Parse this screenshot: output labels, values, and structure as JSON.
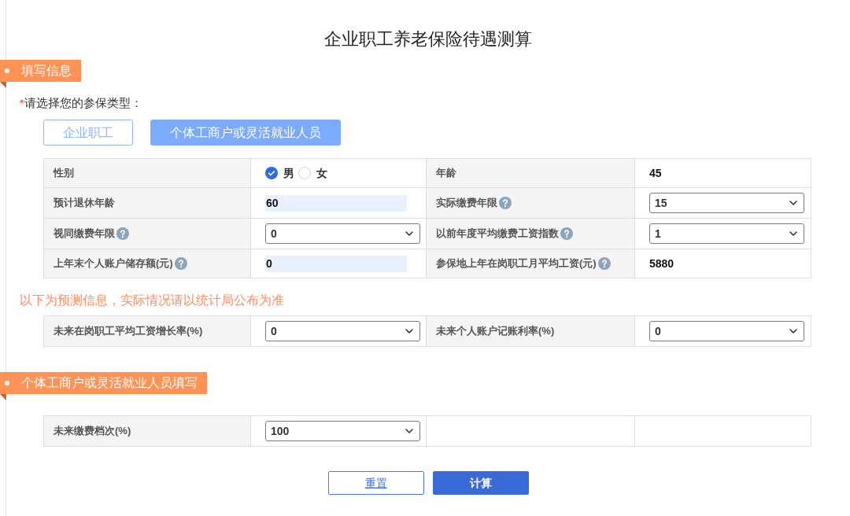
{
  "page_title": "企业职工养老保险待遇测算",
  "fill_section": {
    "heading": "填写信息",
    "type_prompt": {
      "required_mark": "*",
      "text": "请选择您的参保类型："
    },
    "type_options": [
      {
        "label": "企业职工",
        "selected": false
      },
      {
        "label": "个体工商户或灵活就业人员",
        "selected": true
      }
    ],
    "fields": [
      {
        "label": "性别",
        "help": false,
        "kind": "radio",
        "options": [
          {
            "label": "男",
            "selected": true
          },
          {
            "label": "女",
            "selected": false
          }
        ]
      },
      {
        "label": "年龄",
        "help": false,
        "kind": "text",
        "value": "45"
      },
      {
        "label": "预计退休年龄",
        "help": false,
        "kind": "input",
        "value": "60"
      },
      {
        "label": "实际缴费年限",
        "help": true,
        "kind": "select",
        "value": "15"
      },
      {
        "label": "视同缴费年限",
        "help": true,
        "kind": "select",
        "value": "0"
      },
      {
        "label": "以前年度平均缴费工资指数",
        "help": true,
        "kind": "select",
        "value": "1"
      },
      {
        "label": "上年末个人账户储存额(元)",
        "help": true,
        "kind": "input",
        "value": "0"
      },
      {
        "label": "参保地上年在岗职工月平均工资(元)",
        "help": true,
        "kind": "text",
        "value": "5880"
      }
    ]
  },
  "forecast": {
    "note": "以下为预测信息，实际情况请以统计局公布为准",
    "fields": [
      {
        "label": "未来在岗职工平均工资增长率(%)",
        "help": false,
        "kind": "select",
        "value": "0"
      },
      {
        "label": "未来个人账户记账利率(%)",
        "help": false,
        "kind": "select",
        "value": "0"
      }
    ]
  },
  "flexible_section": {
    "heading": "个体工商户或灵活就业人员填写",
    "fields": [
      {
        "label": "未来缴费档次(%)",
        "help": false,
        "kind": "select",
        "value": "100"
      }
    ]
  },
  "buttons": [
    {
      "label": "重置",
      "kind": "outline"
    },
    {
      "label": "计算",
      "kind": "primary"
    }
  ]
}
